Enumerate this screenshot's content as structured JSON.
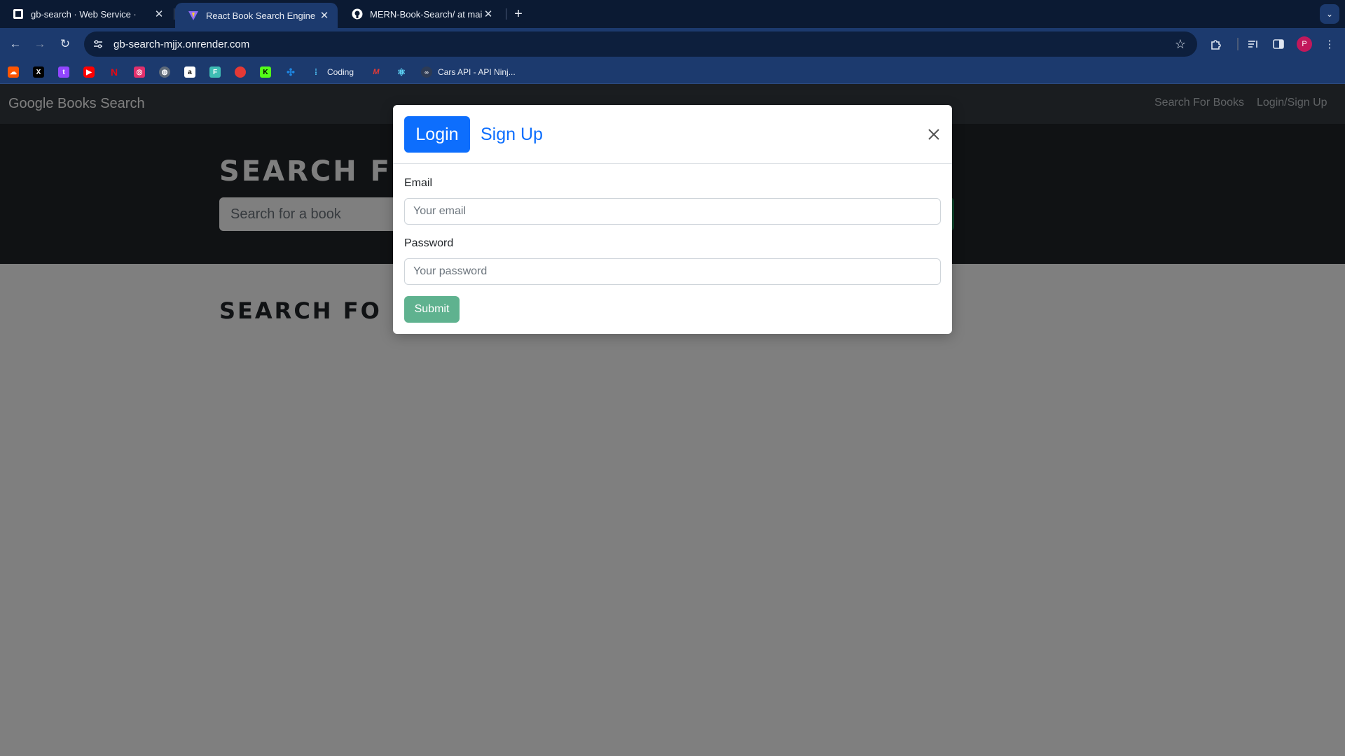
{
  "browser": {
    "tabs": [
      {
        "title": "gb-search · Web Service ·",
        "favicon": "render-icon",
        "active": false
      },
      {
        "title": "React Book Search Engine",
        "favicon": "vite-icon",
        "active": true
      },
      {
        "title": "MERN-Book-Search/ at main",
        "favicon": "github-icon",
        "active": false
      }
    ],
    "new_tab_label": "+",
    "url": "gb-search-mjjx.onrender.com",
    "profile_initial": "P",
    "bookmarks": [
      {
        "label": "",
        "icon": "soundcloud-icon",
        "color": "#ff5500"
      },
      {
        "label": "",
        "icon": "x-icon",
        "color": "#000000"
      },
      {
        "label": "",
        "icon": "twitch-icon",
        "color": "#9146ff"
      },
      {
        "label": "",
        "icon": "youtube-icon",
        "color": "#ff0000"
      },
      {
        "label": "",
        "icon": "netflix-icon",
        "color": "#e50914"
      },
      {
        "label": "",
        "icon": "instagram-icon",
        "color": "#e1306c"
      },
      {
        "label": "",
        "icon": "globe-icon",
        "color": "#5f6b7a"
      },
      {
        "label": "",
        "icon": "amazon-icon",
        "color": "#ffffff"
      },
      {
        "label": "",
        "icon": "frontend-mentor-icon",
        "color": "#3fbdb4"
      },
      {
        "label": "",
        "icon": "red-blob-icon",
        "color": "#e53935"
      },
      {
        "label": "",
        "icon": "kick-icon",
        "color": "#53fc18"
      },
      {
        "label": "",
        "icon": "dev-tool-icon",
        "color": "#1e88e5"
      },
      {
        "label": "Coding",
        "icon": "coding-icon",
        "color": "#4fc3f7"
      },
      {
        "label": "",
        "icon": "m-logo-icon",
        "color": "#e53935"
      },
      {
        "label": "",
        "icon": "react-icon",
        "color": "#61dafb"
      },
      {
        "label": "Cars API - API Ninj...",
        "icon": "api-ninjas-icon",
        "color": "#9aa7b8"
      }
    ]
  },
  "app": {
    "brand": "Google Books Search",
    "nav": {
      "search": "Search For Books",
      "login": "Login/Sign Up"
    },
    "hero_title": "SEARCH F",
    "search_placeholder": "Search for a book",
    "results_title": "SEARCH FO"
  },
  "modal": {
    "tab_login": "Login",
    "tab_signup": "Sign Up",
    "email_label": "Email",
    "email_placeholder": "Your email",
    "password_label": "Password",
    "password_placeholder": "Your password",
    "submit_label": "Submit"
  },
  "colors": {
    "primary": "#0d6efd",
    "success_faded": "#5fb28f",
    "navbar": "#343a40",
    "hero": "#212529"
  }
}
